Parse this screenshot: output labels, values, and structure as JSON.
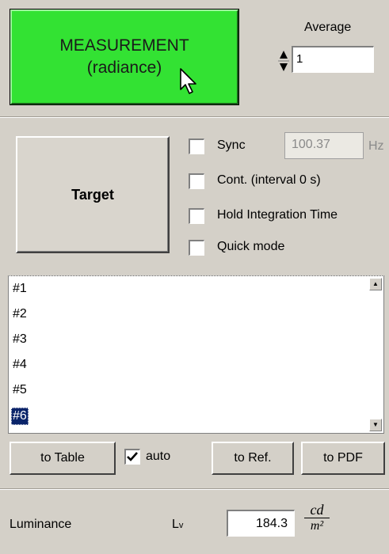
{
  "measurement": {
    "line1": "MEASUREMENT",
    "line2": "(radiance)"
  },
  "average": {
    "label": "Average",
    "value": "1"
  },
  "target_button": "Target",
  "options": [
    {
      "label": "Sync",
      "checked": false
    },
    {
      "label": "Cont. (interval 0 s)",
      "checked": false
    },
    {
      "label": "Hold Integration Time",
      "checked": false
    },
    {
      "label": "Quick mode",
      "checked": false
    }
  ],
  "sync": {
    "value": "100.37",
    "unit": "Hz"
  },
  "list": {
    "items": [
      "#1",
      "#2",
      "#3",
      "#4",
      "#5",
      "#6"
    ],
    "selected": "#6"
  },
  "actions": {
    "to_table": "to Table",
    "auto_label": "auto",
    "auto_checked": true,
    "to_ref": "to Ref.",
    "to_pdf": "to PDF"
  },
  "result": {
    "label": "Luminance",
    "symbol": "L",
    "symbol_sub": "v",
    "value": "184.3",
    "unit_num": "cd",
    "unit_den": "m²"
  },
  "colors": {
    "measure_bg": "#33e233",
    "panel_bg": "#d4d0c8",
    "selection": "#0a246a"
  }
}
